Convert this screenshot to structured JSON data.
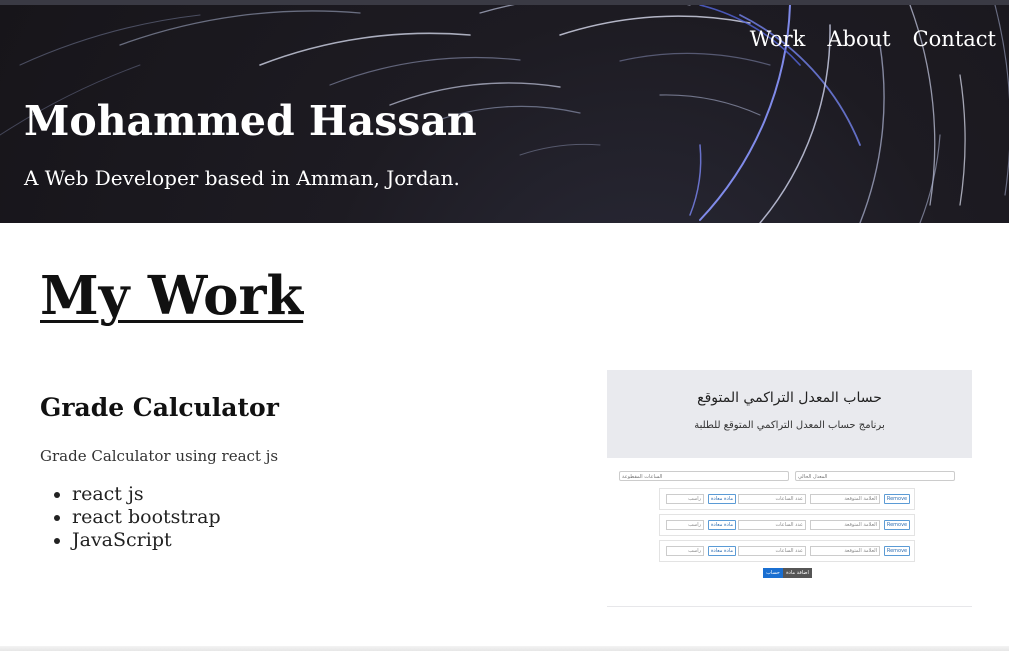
{
  "header": {
    "nav": [
      "Work",
      "About",
      "Contact"
    ],
    "name": "Mohammed Hassan",
    "tagline": "A Web Developer based in Amman, Jordan."
  },
  "work": {
    "heading": "My Work",
    "projects": [
      {
        "title": "Grade Calculator",
        "description": "Grade Calculator using react js",
        "tech": [
          "react js",
          "react bootstrap",
          "JavaScript"
        ],
        "screenshot": {
          "title": "حساب المعدل التراكمي المتوقع",
          "subtitle": "برنامج حساب المعدل التراكمي المتوقع للطلبة",
          "labels": {
            "completed_hours": "الساعات المقطوعة",
            "current_gpa": "المعدل الحالي",
            "expected_grade": "العلامة المتوقعة",
            "hours_count": "عدد الساعات",
            "repeat": "مادة معادة",
            "failed": "راسب",
            "remove": "Remove",
            "add_course": "اضافة مادة",
            "calculate": "حساب"
          }
        }
      }
    ]
  },
  "colors": {
    "hero_bg": "#1d1b22",
    "accent_blue": "#2f6fb3"
  }
}
